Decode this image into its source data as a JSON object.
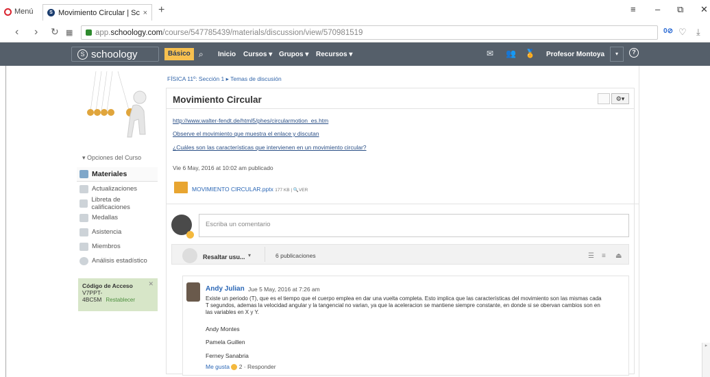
{
  "browser": {
    "menu_label": "Menú",
    "tab_title": "Movimiento Circular | Scho",
    "tab_close": "×",
    "new_tab": "+",
    "url_prefix": "app.",
    "url_host": "schoology.com",
    "url_path": "/course/547785439/materials/discussion/view/570981519",
    "adblock_count": "0"
  },
  "header": {
    "logo": "schoology",
    "plan": "Básico",
    "nav": [
      "Inicio",
      "Cursos ▾",
      "Grupos ▾",
      "Recursos ▾"
    ],
    "user": "Profesor Montoya"
  },
  "sidebar": {
    "course_options": "Opciones del Curso",
    "items": [
      "Materiales",
      "Actualizaciones",
      "Libreta de calificaciones",
      "Medallas",
      "Asistencia",
      "Miembros",
      "Análisis estadístico"
    ],
    "access_title": "Código de Acceso",
    "access_code": "V7PPT-4BC5M",
    "reset": "Restablecer"
  },
  "breadcrumb": "FÍSICA 11º: Sección 1 ▸ Temas de discusión",
  "post": {
    "title": "Movimiento Circular",
    "links": [
      "http://www.walter-fendt.de/html5/phes/circularmotion_es.htm",
      "Observe el movimiento que muestra el enlace  y discutan",
      "¿Cuáles son las características que intervienen en un movimiento circular?"
    ],
    "date": "Vie 6 May, 2016 at 10:02 am publicado",
    "file": "MOVIMIENTO CIRCULAR.pptx",
    "file_size": "177 KB | 🔍VER"
  },
  "comment": {
    "placeholder": "Escriba un comentario"
  },
  "highlight": {
    "label": "Resaltar usu...",
    "count": "6 publicaciones"
  },
  "reply": {
    "author": "Andy Julian",
    "date": "Jue 5 May, 2016 at 7:26 am",
    "text": "Existe un periodo (T), que es el tiempo que el cuerpo emplea en dar una vuelta completa. Esto implica que las características del movimiento son las mismas cada T segundos, ademas la velocidad angular y la tangencial no varian, ya que la aceleracion se mantiene siempre constante, en donde si se obervan cambios son en las variables en X y Y.",
    "names": [
      "Andy Montes",
      "Pamela Guillen",
      "Ferney Sanabria"
    ],
    "like": "Me gusta",
    "likes": "2 · Responder"
  }
}
